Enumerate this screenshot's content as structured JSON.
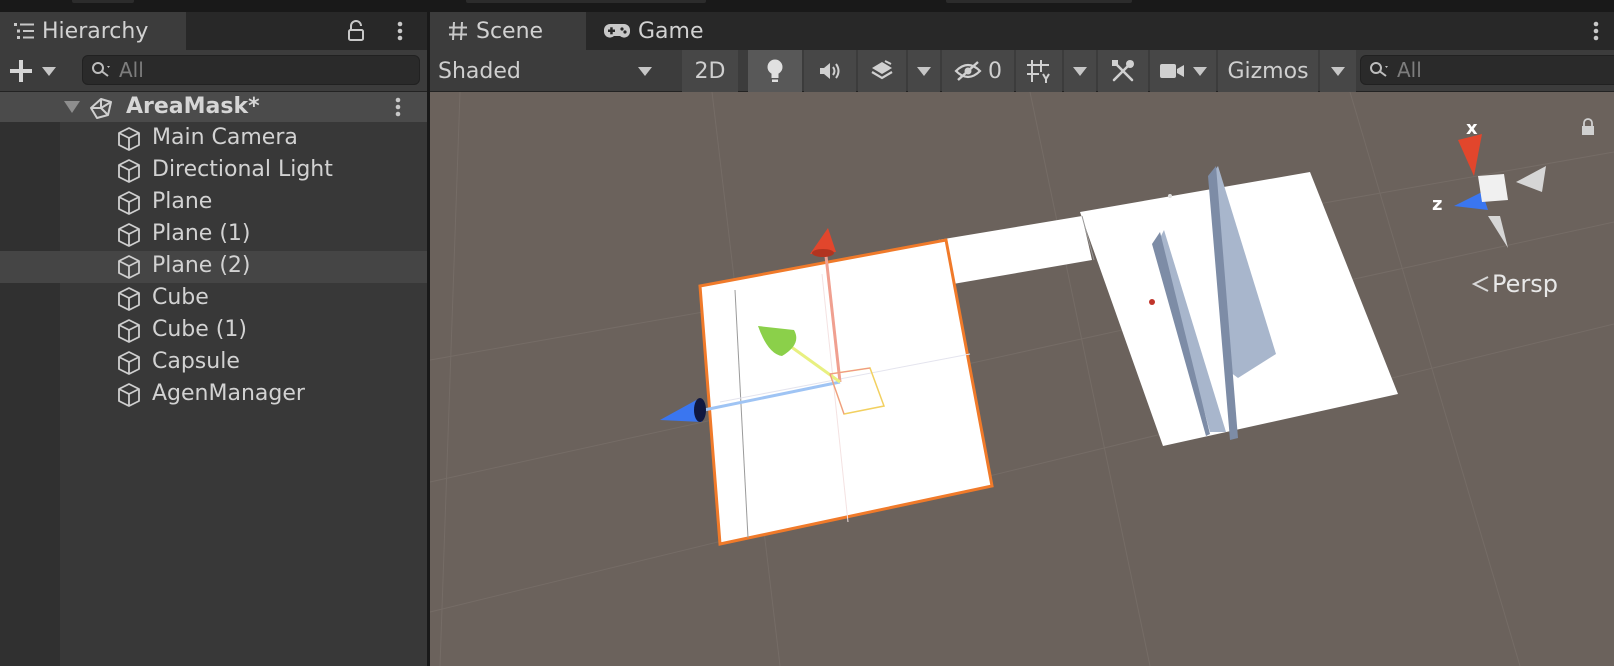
{
  "hierarchy": {
    "tab_label": "Hierarchy",
    "search_placeholder": "All",
    "scene_name": "AreaMask*",
    "items": [
      {
        "label": "Main Camera"
      },
      {
        "label": "Directional Light"
      },
      {
        "label": "Plane"
      },
      {
        "label": "Plane (1)"
      },
      {
        "label": "Plane (2)",
        "selected": true
      },
      {
        "label": "Cube"
      },
      {
        "label": "Cube (1)"
      },
      {
        "label": "Capsule"
      },
      {
        "label": "AgenManager"
      }
    ]
  },
  "scene_view": {
    "tabs": [
      {
        "label": "Scene",
        "icon": "hash-icon",
        "active": true
      },
      {
        "label": "Game",
        "icon": "gamepad-icon",
        "active": false
      }
    ],
    "toolbar": {
      "shading_mode": "Shaded",
      "mode_2d_label": "2D",
      "hidden_count": "0",
      "gizmos_label": "Gizmos",
      "search_placeholder": "All"
    },
    "gizmo": {
      "x_label": "x",
      "z_label": "z",
      "projection_label": "Persp"
    }
  },
  "colors": {
    "panel": "#383838",
    "viewport": "#6b625c",
    "selection_outline": "#f07a2a",
    "axis_x": "#e2462c",
    "axis_z": "#3a76f0",
    "axis_y": "#8bd04a"
  }
}
